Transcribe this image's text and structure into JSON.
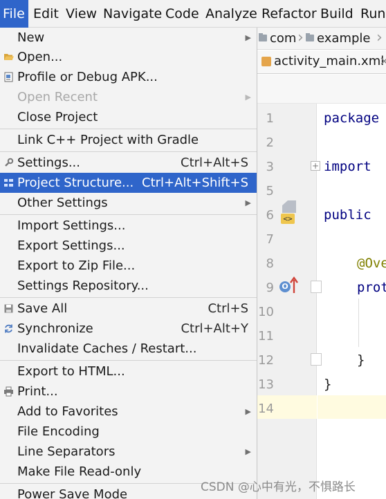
{
  "menubar": {
    "items": [
      "File",
      "Edit",
      "View",
      "Navigate",
      "Code",
      "Analyze",
      "Refactor",
      "Build",
      "Run"
    ]
  },
  "file_menu": {
    "items": [
      {
        "label": "New",
        "submenu": true
      },
      {
        "label": "Open...",
        "icon": "open-folder-icon"
      },
      {
        "label": "Profile or Debug APK...",
        "icon": "apk-icon"
      },
      {
        "label": "Open Recent",
        "submenu": true,
        "disabled": true
      },
      {
        "label": "Close Project"
      },
      {
        "label": "Link C++ Project with Gradle"
      },
      {
        "label": "Settings...",
        "shortcut": "Ctrl+Alt+S",
        "icon": "wrench-icon"
      },
      {
        "label": "Project Structure...",
        "shortcut": "Ctrl+Alt+Shift+S",
        "selected": true,
        "icon": "project-structure-icon"
      },
      {
        "label": "Other Settings",
        "submenu": true
      },
      {
        "label": "Import Settings..."
      },
      {
        "label": "Export Settings..."
      },
      {
        "label": "Export to Zip File..."
      },
      {
        "label": "Settings Repository..."
      },
      {
        "label": "Save All",
        "shortcut": "Ctrl+S",
        "icon": "save-icon"
      },
      {
        "label": "Synchronize",
        "shortcut": "Ctrl+Alt+Y",
        "icon": "sync-icon"
      },
      {
        "label": "Invalidate Caches / Restart..."
      },
      {
        "label": "Export to HTML..."
      },
      {
        "label": "Print...",
        "icon": "print-icon"
      },
      {
        "label": "Add to Favorites",
        "submenu": true
      },
      {
        "label": "File Encoding"
      },
      {
        "label": "Line Separators",
        "submenu": true
      },
      {
        "label": "Make File Read-only"
      },
      {
        "label": "Power Save Mode"
      }
    ]
  },
  "editor": {
    "nav_crumbs": [
      "com",
      "example"
    ],
    "tab_label": "activity_main.xml",
    "tab_close": "×",
    "line_numbers": [
      "1",
      "2",
      "3",
      "5",
      "6",
      "7",
      "8",
      "9",
      "10",
      "11",
      "12",
      "13",
      "14"
    ],
    "code": {
      "line1": "package",
      "line3": "import",
      "line6": "public",
      "line8": "@Ove",
      "line9": "prot",
      "line12": "}",
      "line13": "}"
    },
    "gutter_badge": "<>",
    "override_marker": "O"
  },
  "watermark": "CSDN @心中有光，不惧路长",
  "colors": {
    "selection": "#2f65ca",
    "menu_bg": "#f3f3f3",
    "keyword": "#000080",
    "annotation": "#808000",
    "current_line": "#fffbe0"
  }
}
